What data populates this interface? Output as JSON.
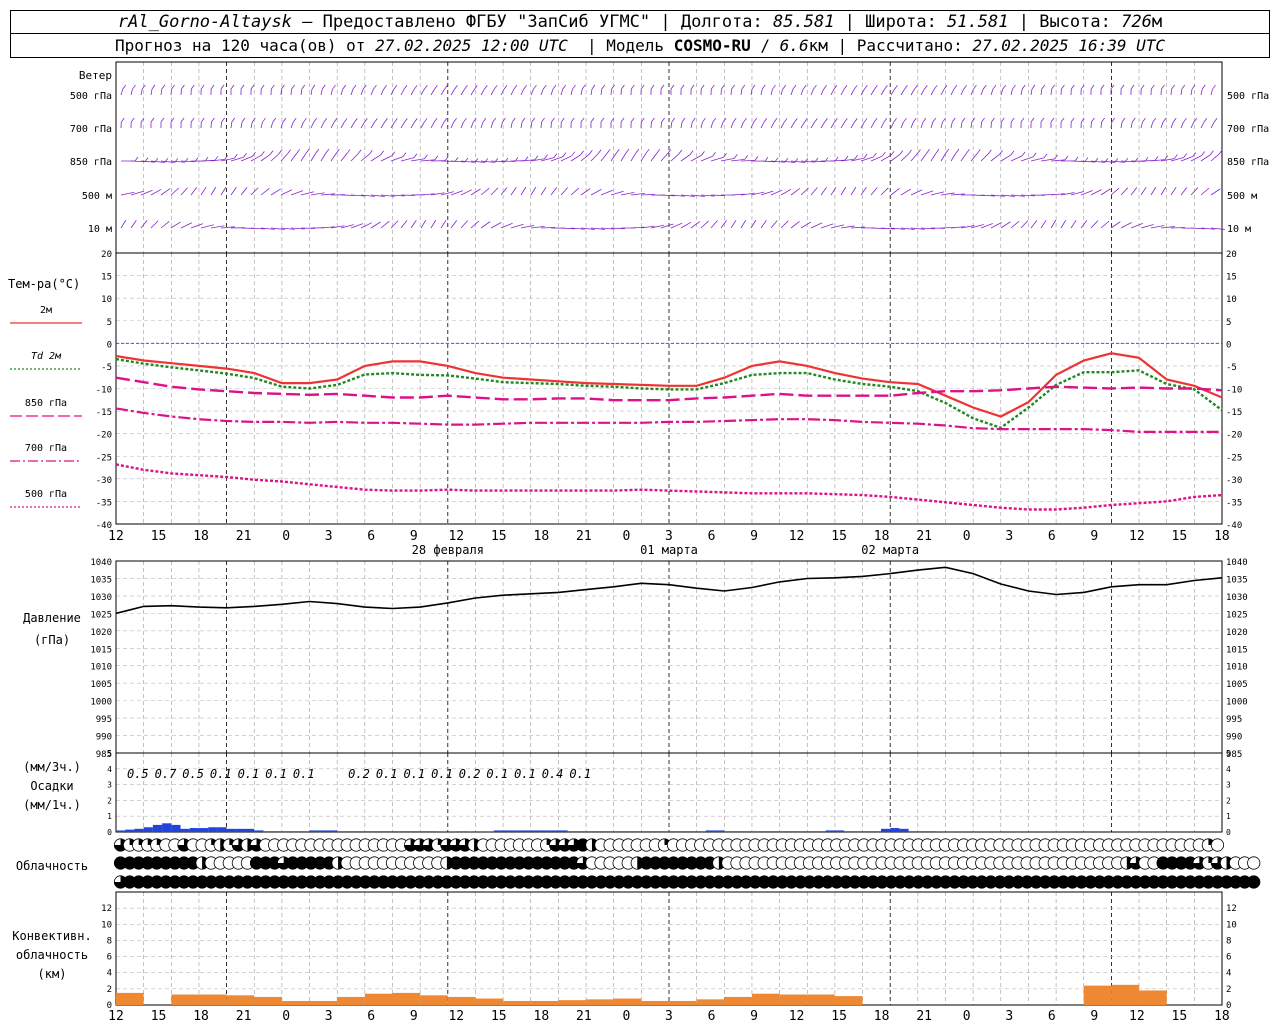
{
  "header": {
    "station": "rAl_Gorno-Altaysk",
    "provider": "Предоставлено ФГБУ \"ЗапСиб УГМС\"",
    "lon_label": "Долгота:",
    "lon": "85.581",
    "lat_label": "Широта:",
    "lat": "51.581",
    "alt_label": "Высота:",
    "alt": "726",
    "alt_unit": "м",
    "forecast_prefix": "Прогноз на 120 часа(ов) от",
    "forecast_time": "27.02.2025 12:00 UTC",
    "model_label": "Модель",
    "model": "COSMO-RU",
    "resolution": "6.6",
    "res_unit": "км",
    "calc_label": "Рассчитано:",
    "calc_time": "27.02.2025 16:39 UTC"
  },
  "wind_panel": {
    "title": "Ветер",
    "levels": [
      "500 гПа",
      "700 гПа",
      "850 гПа",
      "500 м",
      "10 м"
    ]
  },
  "temp_panel": {
    "title": "Тем-ра(°C)",
    "legend": [
      {
        "label": "2м",
        "color": "#ee3333",
        "dash": "solid"
      },
      {
        "label": "Td 2м",
        "color": "#228822",
        "dash": "dotted"
      },
      {
        "label": "850 гПа",
        "color": "#dd1188",
        "dash": "long-dash"
      },
      {
        "label": "700 гПа",
        "color": "#dd1188",
        "dash": "dash-dot"
      },
      {
        "label": "500 гПа",
        "color": "#dd1188",
        "dash": "dotted"
      }
    ],
    "ylim": [
      -40,
      20
    ],
    "yticks": [
      "20",
      "15",
      "10",
      "5",
      "0",
      "-5",
      "-10",
      "-15",
      "-20",
      "-25",
      "-30",
      "-35",
      "-40"
    ]
  },
  "time_axis": {
    "hour_labels": [
      "12",
      "15",
      "18",
      "21",
      "0",
      "3",
      "6",
      "9",
      "12",
      "15",
      "18",
      "21",
      "0",
      "3",
      "6",
      "9",
      "12",
      "15",
      "18",
      "21",
      "0",
      "3",
      "6",
      "9",
      "12",
      "15",
      "18"
    ],
    "dates": [
      "28 февраля",
      "01 марта",
      "02 марта"
    ]
  },
  "pressure_panel": {
    "title1": "Давление",
    "title2": "(гПа)",
    "ylim": [
      985,
      1040
    ],
    "yticks": [
      "1040",
      "1035",
      "1030",
      "1025",
      "1020",
      "1015",
      "1010",
      "1005",
      "1000",
      "995",
      "990",
      "985"
    ]
  },
  "precip_panel": {
    "unit_top": "(мм/3ч.)",
    "title": "Осадки",
    "unit_bottom": "(мм/1ч.)",
    "yticks": [
      "5",
      "4",
      "3",
      "2",
      "1",
      "0"
    ],
    "amounts_3h": [
      "0.5",
      "0.7",
      "0.5",
      "0.1",
      "0.1",
      "0.1",
      "0.1",
      "",
      "0.2",
      "0.1",
      "0.1",
      "0.1",
      "0.2",
      "0.1",
      "0.1",
      "0.4",
      "0.1",
      "",
      "",
      "",
      "",
      "",
      "",
      "",
      "",
      "",
      "",
      ""
    ]
  },
  "cloud_panel": {
    "title": "Облачность",
    "rows": [
      [
        75,
        25,
        25,
        25,
        25,
        0,
        0,
        75,
        0,
        0,
        25,
        50,
        25,
        75,
        50,
        75,
        0,
        0,
        0,
        0,
        0,
        0,
        0,
        0,
        0,
        0,
        0,
        0,
        0,
        0,
        0,
        0,
        75,
        75,
        75,
        25,
        75,
        75,
        75,
        50,
        0,
        0,
        0,
        0,
        0,
        0,
        0,
        25,
        75,
        75,
        75,
        100,
        50,
        0,
        0,
        0,
        0,
        0,
        0,
        0,
        25,
        0,
        0,
        0,
        0,
        0,
        0,
        0,
        0,
        0,
        0,
        0,
        0,
        0,
        0,
        0,
        0,
        0,
        0,
        0,
        0,
        0,
        0,
        0,
        0,
        0,
        0,
        0,
        0,
        0,
        0,
        0,
        0,
        0,
        0,
        0,
        0,
        0,
        0,
        0,
        0,
        0,
        0,
        0,
        0,
        0,
        0,
        0,
        0,
        0,
        0,
        0,
        0,
        0,
        0,
        0,
        0,
        0,
        0,
        0,
        25,
        0
      ],
      [
        100,
        100,
        100,
        100,
        100,
        100,
        100,
        100,
        100,
        50,
        0,
        0,
        0,
        0,
        0,
        100,
        100,
        100,
        75,
        100,
        100,
        100,
        100,
        100,
        50,
        0,
        0,
        0,
        0,
        0,
        0,
        0,
        0,
        0,
        0,
        0,
        50,
        100,
        100,
        100,
        100,
        100,
        100,
        100,
        100,
        100,
        100,
        100,
        100,
        100,
        100,
        75,
        0,
        0,
        0,
        0,
        0,
        50,
        100,
        100,
        100,
        100,
        100,
        100,
        100,
        100,
        50,
        0,
        0,
        0,
        0,
        0,
        0,
        0,
        0,
        0,
        0,
        0,
        0,
        0,
        0,
        0,
        0,
        0,
        0,
        0,
        0,
        0,
        0,
        0,
        0,
        0,
        0,
        0,
        0,
        0,
        0,
        0,
        0,
        0,
        0,
        0,
        0,
        0,
        0,
        0,
        0,
        0,
        0,
        0,
        0,
        50,
        75,
        0,
        0,
        100,
        100,
        100,
        100,
        75,
        25,
        75,
        50,
        0,
        0,
        0
      ],
      [
        75,
        100,
        100,
        100,
        100,
        100,
        100,
        100,
        100,
        100,
        100,
        100,
        100,
        100,
        100,
        100,
        100,
        100,
        100,
        100,
        100,
        100,
        100,
        100,
        100,
        100,
        100,
        100,
        100,
        100,
        100,
        100,
        100,
        100,
        100,
        100,
        100,
        100,
        100,
        100,
        100,
        100,
        100,
        100,
        100,
        100,
        100,
        100,
        100,
        100,
        100,
        100,
        100,
        100,
        100,
        100,
        100,
        100,
        100,
        100,
        100,
        100,
        100,
        100,
        100,
        100,
        100,
        100,
        100,
        100,
        100,
        100,
        100,
        100,
        100,
        100,
        100,
        100,
        100,
        100,
        100,
        100,
        100,
        100,
        100,
        100,
        100,
        100,
        100,
        100,
        100,
        100,
        100,
        100,
        100,
        100,
        100,
        100,
        100,
        100,
        100,
        100,
        100,
        100,
        100,
        100,
        100,
        100,
        100,
        100,
        100,
        100,
        100,
        100,
        100,
        100,
        100,
        100,
        100,
        100,
        100,
        100,
        100,
        100,
        100,
        100
      ]
    ]
  },
  "conv_panel": {
    "title1": "Конвективн.",
    "title2": "облачность",
    "title3": "(км)",
    "yticks": [
      "12",
      "10",
      "8",
      "6",
      "4",
      "2",
      "0"
    ]
  },
  "colors": {
    "wind": "#8822cc",
    "t2m": "#ee3333",
    "td2m": "#228822",
    "upper": "#dd1188",
    "zero_line": "#3333ee",
    "pressure": "#000000",
    "precip_bar": "#2244dd",
    "conv_bar": "#ee8833"
  },
  "chart_data": [
    {
      "type": "line",
      "title": "Тем-ра(°C)",
      "ylim": [
        -40,
        20
      ],
      "x_hours": [
        0,
        3,
        6,
        9,
        12,
        15,
        18,
        21,
        24,
        27,
        30,
        33,
        36,
        39,
        42,
        45,
        48,
        51,
        54,
        57,
        60,
        63,
        66,
        69,
        72,
        75,
        78,
        81,
        84,
        87,
        90,
        93,
        96,
        99,
        102,
        105,
        108,
        111,
        114,
        117,
        120
      ],
      "series": [
        {
          "name": "2м",
          "values": [
            -2.8,
            -3.8,
            -4.4,
            -5,
            -5.6,
            -6.6,
            -8.8,
            -8.8,
            -8,
            -5,
            -4,
            -4,
            -5,
            -6.6,
            -7.6,
            -8,
            -8.4,
            -8.8,
            -9,
            -9.2,
            -9.4,
            -9.4,
            -7.6,
            -5,
            -4,
            -5,
            -6.6,
            -7.8,
            -8.6,
            -9,
            -11.6,
            -14.2,
            -16.2,
            -13,
            -7,
            -3.8,
            -2.2,
            -3.2,
            -8,
            -9.4,
            -12
          ]
        },
        {
          "name": "Td 2м",
          "values": [
            -3.5,
            -4.5,
            -5.3,
            -6,
            -6.7,
            -7.7,
            -9.6,
            -10,
            -9.2,
            -6.9,
            -6.6,
            -7,
            -7.1,
            -7.8,
            -8.6,
            -8.8,
            -9,
            -9.4,
            -9.6,
            -10,
            -10.2,
            -10.2,
            -8.8,
            -7,
            -6.6,
            -6.6,
            -8,
            -9,
            -9.6,
            -10.6,
            -13.2,
            -16.6,
            -18.7,
            -14.2,
            -9.2,
            -6.4,
            -6.4,
            -6,
            -9,
            -10.2,
            -14.8
          ]
        },
        {
          "name": "850 гПа",
          "values": [
            -7.6,
            -8.6,
            -9.6,
            -10.2,
            -10.6,
            -11,
            -11.2,
            -11.4,
            -11.2,
            -11.6,
            -12,
            -12,
            -11.6,
            -12,
            -12.4,
            -12.4,
            -12.2,
            -12.2,
            -12.6,
            -12.6,
            -12.6,
            -12.2,
            -12,
            -11.6,
            -11.2,
            -11.6,
            -11.6,
            -11.6,
            -11.6,
            -11,
            -10.6,
            -10.6,
            -10.4,
            -10,
            -9.6,
            -9.8,
            -10,
            -9.8,
            -10,
            -10,
            -10.4
          ]
        },
        {
          "name": "700 гПа",
          "values": [
            -14.4,
            -15.4,
            -16.2,
            -16.8,
            -17.2,
            -17.4,
            -17.4,
            -17.6,
            -17.4,
            -17.6,
            -17.6,
            -17.8,
            -18,
            -18,
            -17.8,
            -17.6,
            -17.6,
            -17.6,
            -17.6,
            -17.6,
            -17.4,
            -17.4,
            -17.2,
            -17,
            -16.8,
            -16.8,
            -17,
            -17.4,
            -17.6,
            -17.8,
            -18.2,
            -18.8,
            -19,
            -19,
            -19,
            -19,
            -19.2,
            -19.6,
            -19.6,
            -19.6,
            -19.6
          ]
        },
        {
          "name": "500 гПа",
          "values": [
            -26.8,
            -28,
            -28.8,
            -29.2,
            -29.6,
            -30.2,
            -30.6,
            -31.2,
            -31.8,
            -32.4,
            -32.6,
            -32.6,
            -32.4,
            -32.6,
            -32.6,
            -32.6,
            -32.6,
            -32.6,
            -32.6,
            -32.4,
            -32.6,
            -32.8,
            -33,
            -33.2,
            -33.2,
            -33.2,
            -33.4,
            -33.6,
            -34,
            -34.6,
            -35.2,
            -35.8,
            -36.4,
            -36.8,
            -36.8,
            -36.4,
            -35.8,
            -35.4,
            -35,
            -34,
            -33.6
          ]
        }
      ]
    },
    {
      "type": "line",
      "title": "Давление (гПа)",
      "ylim": [
        985,
        1040
      ],
      "x_hours": [
        0,
        3,
        6,
        9,
        12,
        15,
        18,
        21,
        24,
        27,
        30,
        33,
        36,
        39,
        42,
        45,
        48,
        51,
        54,
        57,
        60,
        63,
        66,
        69,
        72,
        75,
        78,
        81,
        84,
        87,
        90,
        93,
        96,
        99,
        102,
        105,
        108,
        111,
        114,
        117,
        120
      ],
      "series": [
        {
          "name": "Давление",
          "values": [
            1025,
            1027,
            1027.2,
            1026.8,
            1026.6,
            1027,
            1027.6,
            1028.4,
            1027.8,
            1026.8,
            1026.4,
            1026.8,
            1028,
            1029.4,
            1030.2,
            1030.6,
            1031,
            1031.8,
            1032.6,
            1033.6,
            1033.2,
            1032.2,
            1031.4,
            1032.4,
            1034,
            1035,
            1035.2,
            1035.6,
            1036.4,
            1037.4,
            1038.2,
            1036.4,
            1033.4,
            1031.4,
            1030.4,
            1031,
            1032.6,
            1033.2,
            1033.2,
            1034.4,
            1035.2
          ]
        }
      ]
    },
    {
      "type": "bar",
      "title": "Осадки (мм/1ч.)",
      "ylim": [
        0,
        5
      ],
      "x_hours_start": [
        0,
        1,
        2,
        3,
        4,
        5,
        6,
        7,
        8,
        9,
        10,
        11,
        12,
        13,
        14,
        15,
        16,
        17,
        18,
        19,
        20,
        21,
        22,
        23,
        24,
        25,
        26,
        27,
        28,
        29,
        30,
        31,
        32,
        33,
        34,
        35,
        36,
        37,
        38,
        39,
        40,
        41,
        42,
        43,
        44,
        45,
        46,
        47,
        48,
        49,
        50,
        51,
        52,
        53,
        54,
        55,
        56,
        57,
        58,
        59,
        60,
        61,
        62,
        63,
        64,
        65,
        66,
        67,
        68,
        69,
        70,
        71,
        72,
        73,
        74,
        75,
        76,
        77,
        78,
        79,
        80,
        81,
        82,
        83,
        84,
        85,
        86,
        87,
        88,
        89
      ],
      "values": [
        0.1,
        0.15,
        0.2,
        0.3,
        0.45,
        0.55,
        0.45,
        0.2,
        0.25,
        0.25,
        0.3,
        0.3,
        0.2,
        0.2,
        0.2,
        0.1,
        0.05,
        0.05,
        0.05,
        0.05,
        0.05,
        0.1,
        0.1,
        0.1,
        0.05,
        0.05,
        0.05,
        0.05,
        0.05,
        0.05,
        0.05,
        0.05,
        0.05,
        0.05,
        0.05,
        0,
        0,
        0.05,
        0,
        0,
        0,
        0.1,
        0.1,
        0.1,
        0.1,
        0.1,
        0.1,
        0.1,
        0.1,
        0.05,
        0.05,
        0.05,
        0.05,
        0.05,
        0.05,
        0.05,
        0.05,
        0.05,
        0.05,
        0.05,
        0.05,
        0.05,
        0.05,
        0.05,
        0.1,
        0.1,
        0.05,
        0.05,
        0.05,
        0.05,
        0.05,
        0.05,
        0.05,
        0.05,
        0.05,
        0.05,
        0.05,
        0.1,
        0.1,
        0.05,
        0.05,
        0.05,
        0.05,
        0.2,
        0.25,
        0.2,
        0.05,
        0.05,
        0.05,
        0
      ]
    },
    {
      "type": "bar",
      "title": "Конвективн. облачность (км)",
      "ylim": [
        0,
        14
      ],
      "x_hours_start": [
        0,
        3,
        6,
        9,
        12,
        15,
        18,
        21,
        24,
        27,
        30,
        33,
        36,
        39,
        42,
        45,
        48,
        51,
        54,
        57,
        60,
        63,
        66,
        69,
        72,
        75,
        78,
        81,
        84,
        87,
        90,
        93,
        96,
        99,
        102,
        105,
        108,
        111,
        114,
        117
      ],
      "values": [
        1.5,
        0,
        1.3,
        1.3,
        1.2,
        1,
        0.5,
        0.5,
        1,
        1.4,
        1.5,
        1.2,
        1,
        0.8,
        0.5,
        0.5,
        0.6,
        0.7,
        0.8,
        0.5,
        0.5,
        0.7,
        1,
        1.4,
        1.3,
        1.3,
        1.1,
        0,
        0,
        0,
        0,
        0,
        0,
        0,
        0,
        2.4,
        2.5,
        1.8,
        0,
        0
      ]
    }
  ]
}
